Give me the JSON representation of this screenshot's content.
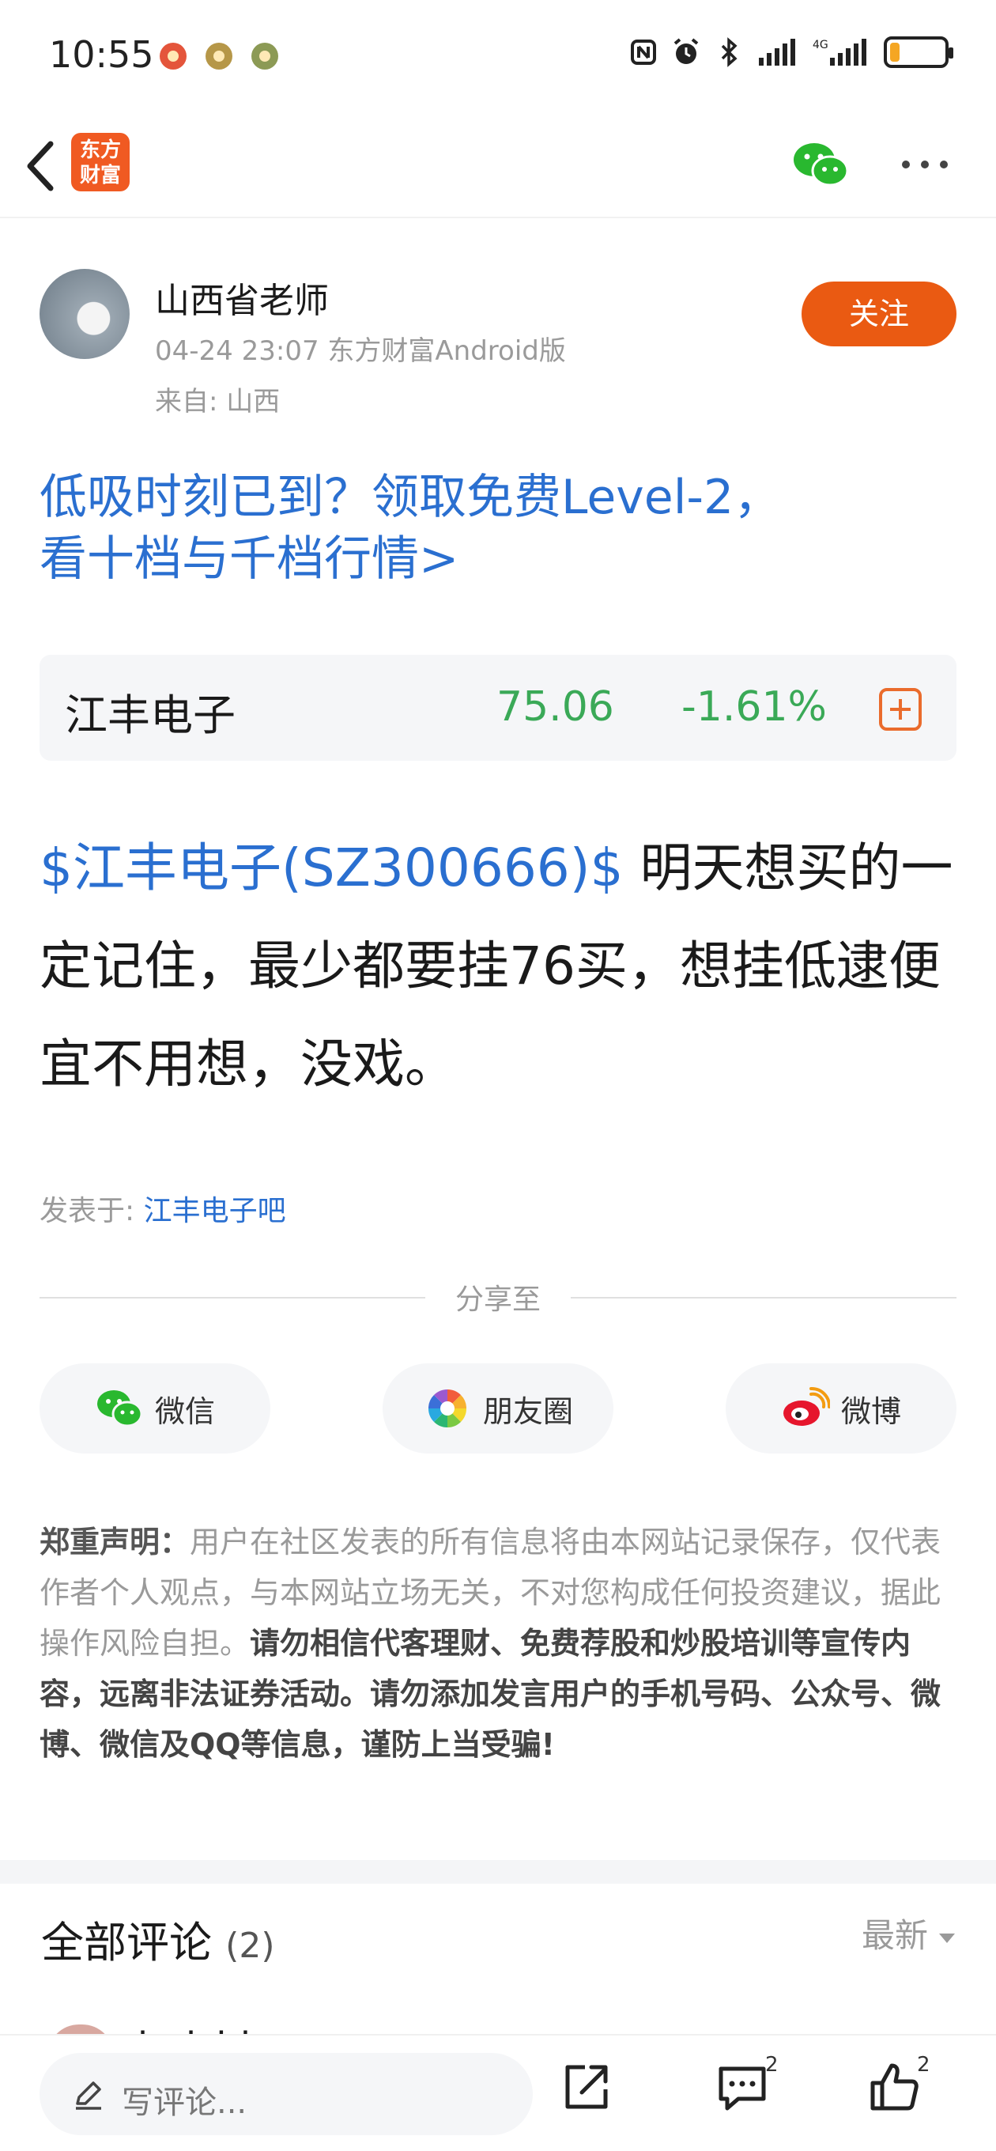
{
  "status": {
    "time": "10:55",
    "network": "4G",
    "battery_level": 0.18
  },
  "nav": {
    "logo_text_line1": "东方",
    "logo_text_line2": "财富",
    "back_icon": "chevron-left-icon",
    "share_icon": "wechat-icon",
    "more_icon": "more-dots-icon"
  },
  "author": {
    "name": "山西省老师",
    "meta": "04-24 23:07 东方财富Android版",
    "from": "来自: 山西",
    "follow_label": "关注"
  },
  "promo": {
    "line1": "低吸时刻已到？领取免费Level-2，",
    "line2": "看十档与千档行情>"
  },
  "stock": {
    "name": "江丰电子",
    "price": "75.06",
    "change": "-1.61%"
  },
  "post": {
    "stock_tag": "$江丰电子(SZ300666)$",
    "text": " 明天想买的一定记住，最少都要挂76买，想挂低逮便宜不用想，没戏。",
    "posted_in_label": "发表于: ",
    "bar_name": "江丰电子吧"
  },
  "share": {
    "title": "分享至",
    "wechat": "微信",
    "moments": "朋友圈",
    "weibo": "微博"
  },
  "disclaimer": {
    "label": "郑重声明：",
    "normal": "用户在社区发表的所有信息将由本网站记录保存，仅代表作者个人观点，与本网站立场无关，不对您构成任何投资建议，据此操作风险自担。",
    "strong": "请勿相信代客理财、免费荐股和炒股培训等宣传内容，远离非法证券活动。请勿添加发言用户的手机号码、公众号、微博、微信及QQ等信息，谨防上当受骗!"
  },
  "comments": {
    "title": "全部评论",
    "count": "(2)",
    "sort": "最新",
    "first_author_partial": "hulzhi"
  },
  "bottom": {
    "placeholder": "写评论...",
    "comment_count": "2",
    "like_count": "2"
  },
  "colors": {
    "accent_blue": "#2a6fd0",
    "brand_orange": "#ea5a12",
    "down_green": "#3aa957"
  }
}
